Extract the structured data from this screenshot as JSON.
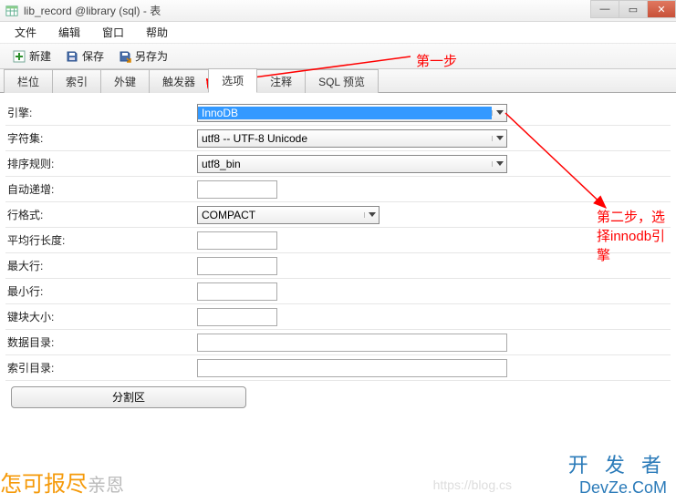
{
  "window": {
    "title": "lib_record @library (sql) - 表"
  },
  "menu": {
    "file": "文件",
    "edit": "编辑",
    "window": "窗口",
    "help": "帮助"
  },
  "toolbar": {
    "new": "新建",
    "save": "保存",
    "save_as": "另存为"
  },
  "tabs": {
    "t0": "栏位",
    "t1": "索引",
    "t2": "外键",
    "t3": "触发器",
    "t4": "选项",
    "t5": "注释",
    "t6": "SQL 预览"
  },
  "labels": {
    "engine": "引擎:",
    "charset": "字符集:",
    "collation": "排序规则:",
    "auto_inc": "自动递增:",
    "row_format": "行格式:",
    "avg_row_len": "平均行长度:",
    "max_rows": "最大行:",
    "min_rows": "最小行:",
    "key_block": "键块大小:",
    "data_dir": "数据目录:",
    "index_dir": "索引目录:"
  },
  "values": {
    "engine": "InnoDB",
    "charset": "utf8 -- UTF-8 Unicode",
    "collation": "utf8_bin",
    "auto_inc": "",
    "row_format": "COMPACT",
    "avg_row_len": "",
    "max_rows": "",
    "min_rows": "",
    "key_block": "",
    "data_dir": "",
    "index_dir": ""
  },
  "buttons": {
    "partition": "分割区"
  },
  "annotations": {
    "step1": "第一步",
    "step2": "第二步，选择innodb引擎"
  },
  "watermark": {
    "url": "https://blog.cs",
    "brand_cn": "开 发 者",
    "brand_en": "DevZe.CoM",
    "left1": "怎可报尽",
    "left2": "亲恩"
  }
}
